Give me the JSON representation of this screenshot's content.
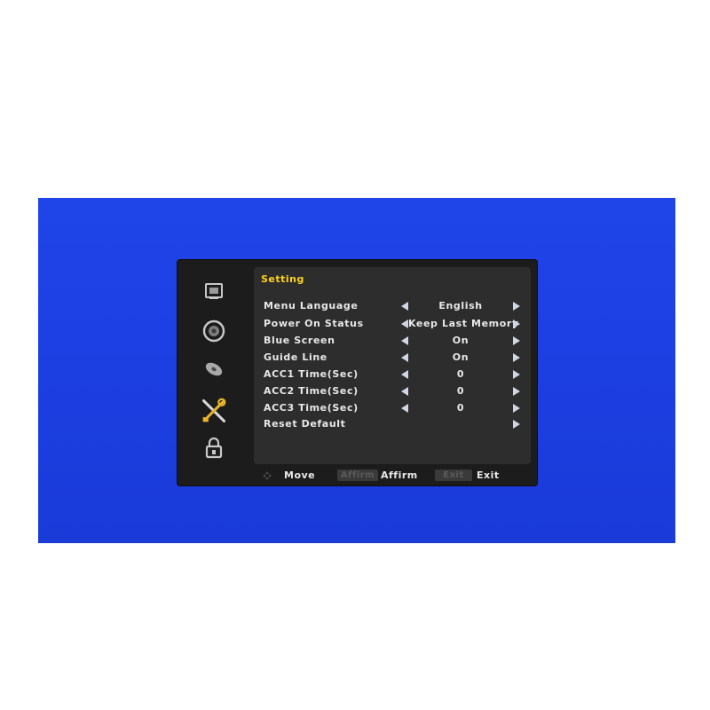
{
  "osd": {
    "title": "Setting",
    "sidebar": [
      {
        "icon": "picture-icon"
      },
      {
        "icon": "sound-icon"
      },
      {
        "icon": "disc-icon"
      },
      {
        "icon": "tools-icon",
        "selected": true
      },
      {
        "icon": "lock-icon"
      }
    ],
    "rows": [
      {
        "label": "Menu Language",
        "value": "English",
        "has_left": true,
        "has_right": true
      },
      {
        "label": "Power On Status",
        "value": "Keep Last Memory",
        "has_left": true,
        "has_right": true
      },
      {
        "label": "Blue Screen",
        "value": "On",
        "has_left": true,
        "has_right": true
      },
      {
        "label": "Guide Line",
        "value": "On",
        "has_left": true,
        "has_right": true
      },
      {
        "label": "ACC1 Time(Sec)",
        "value": "0",
        "has_left": true,
        "has_right": true
      },
      {
        "label": "ACC2 Time(Sec)",
        "value": "0",
        "has_left": true,
        "has_right": true
      },
      {
        "label": "ACC3 Time(Sec)",
        "value": "0",
        "has_left": true,
        "has_right": true
      },
      {
        "label": "Reset Default",
        "value": "",
        "has_left": false,
        "has_right": true
      }
    ],
    "footer": {
      "move_label": "Move",
      "affirm_key": "Affirm",
      "affirm_label": "Affirm",
      "exit_key": "Exit",
      "exit_label": "Exit"
    }
  },
  "colors": {
    "screen_blue": "#1f44e8",
    "osd_background": "#1c1c1c",
    "panel_background": "#2d2d2d",
    "title": "#ffd21a",
    "text": "#e8e8e8"
  }
}
